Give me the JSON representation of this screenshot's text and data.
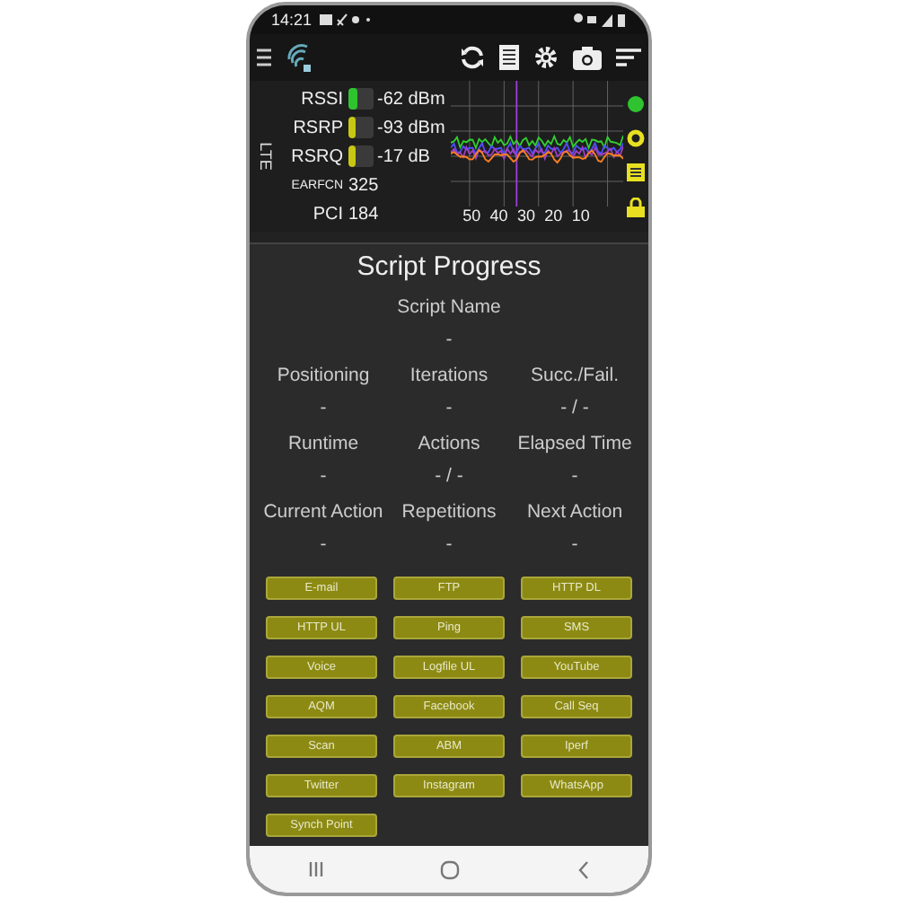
{
  "status_bar": {
    "time": "14:21"
  },
  "signal": {
    "technology": "LTE",
    "rows": [
      {
        "kind": "bar",
        "label": "RSSI",
        "value": "-62 dBm",
        "level": 0.35,
        "color": "#2fc42f"
      },
      {
        "kind": "bar",
        "label": "RSRP",
        "value": "-93 dBm",
        "level": 0.3,
        "color": "#c8c814"
      },
      {
        "kind": "bar",
        "label": "RSRQ",
        "value": "-17 dB",
        "level": 0.3,
        "color": "#c8c814"
      },
      {
        "kind": "small",
        "label": "EARFCN",
        "value": "325"
      },
      {
        "kind": "plain",
        "label": "PCI",
        "value": "184"
      }
    ],
    "chart_ticks": [
      "50",
      "40",
      "30",
      "20",
      "10"
    ]
  },
  "title": "Script Progress",
  "script_name": {
    "label": "Script Name",
    "value": "-"
  },
  "fields": [
    {
      "label": "Positioning",
      "value": "-"
    },
    {
      "label": "Iterations",
      "value": "-"
    },
    {
      "label": "Succ./Fail.",
      "value": "- / -"
    },
    {
      "label": "Runtime",
      "value": "-"
    },
    {
      "label": "Actions",
      "value": "- / -"
    },
    {
      "label": "Elapsed Time",
      "value": "-"
    },
    {
      "label": "Current Action",
      "value": "-"
    },
    {
      "label": "Repetitions",
      "value": "-"
    },
    {
      "label": "Next Action",
      "value": "-"
    }
  ],
  "actions": [
    "E-mail",
    "FTP",
    "HTTP DL",
    "HTTP UL",
    "Ping",
    "SMS",
    "Voice",
    "Logfile UL",
    "YouTube",
    "AQM",
    "Facebook",
    "Call Seq",
    "Scan",
    "ABM",
    "Iperf",
    "Twitter",
    "Instagram",
    "WhatsApp",
    "Synch Point"
  ]
}
